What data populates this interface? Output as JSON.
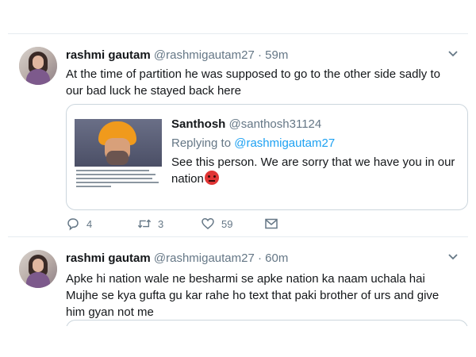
{
  "tweets": [
    {
      "author_name": "rashmi gautam",
      "handle": "@rashmigautam27",
      "separator": "·",
      "time": "59m",
      "text": "At the time of partition he was supposed to go to the other side sadly to our bad luck he stayed back here",
      "quoted": {
        "author_name": "Santhosh",
        "handle": "@santhosh31124",
        "replying_prefix": "Replying to",
        "replying_to": "@rashmigautam27",
        "text": "See this person. We are sorry that we have you in our nation"
      },
      "actions": {
        "reply_count": "4",
        "retweet_count": "3",
        "like_count": "59"
      }
    },
    {
      "author_name": "rashmi gautam",
      "handle": "@rashmigautam27",
      "separator": "·",
      "time": "60m",
      "text_line1": "Apke hi nation wale ne besharmi  se apke nation ka naam  uchala hai",
      "text_line2": "Mujhe se kya gufta gu kar rahe ho text that paki brother of urs and give him gyan not me"
    }
  ],
  "icons": {
    "reply": "reply-icon",
    "retweet": "retweet-icon",
    "like": "heart-icon",
    "dm": "envelope-icon",
    "more": "chevron-down-icon",
    "emoji": "angry-face-emoji"
  },
  "colors": {
    "text": "#14171a",
    "muted": "#657786",
    "link": "#1da1f2",
    "border": "#e6ecf0"
  }
}
